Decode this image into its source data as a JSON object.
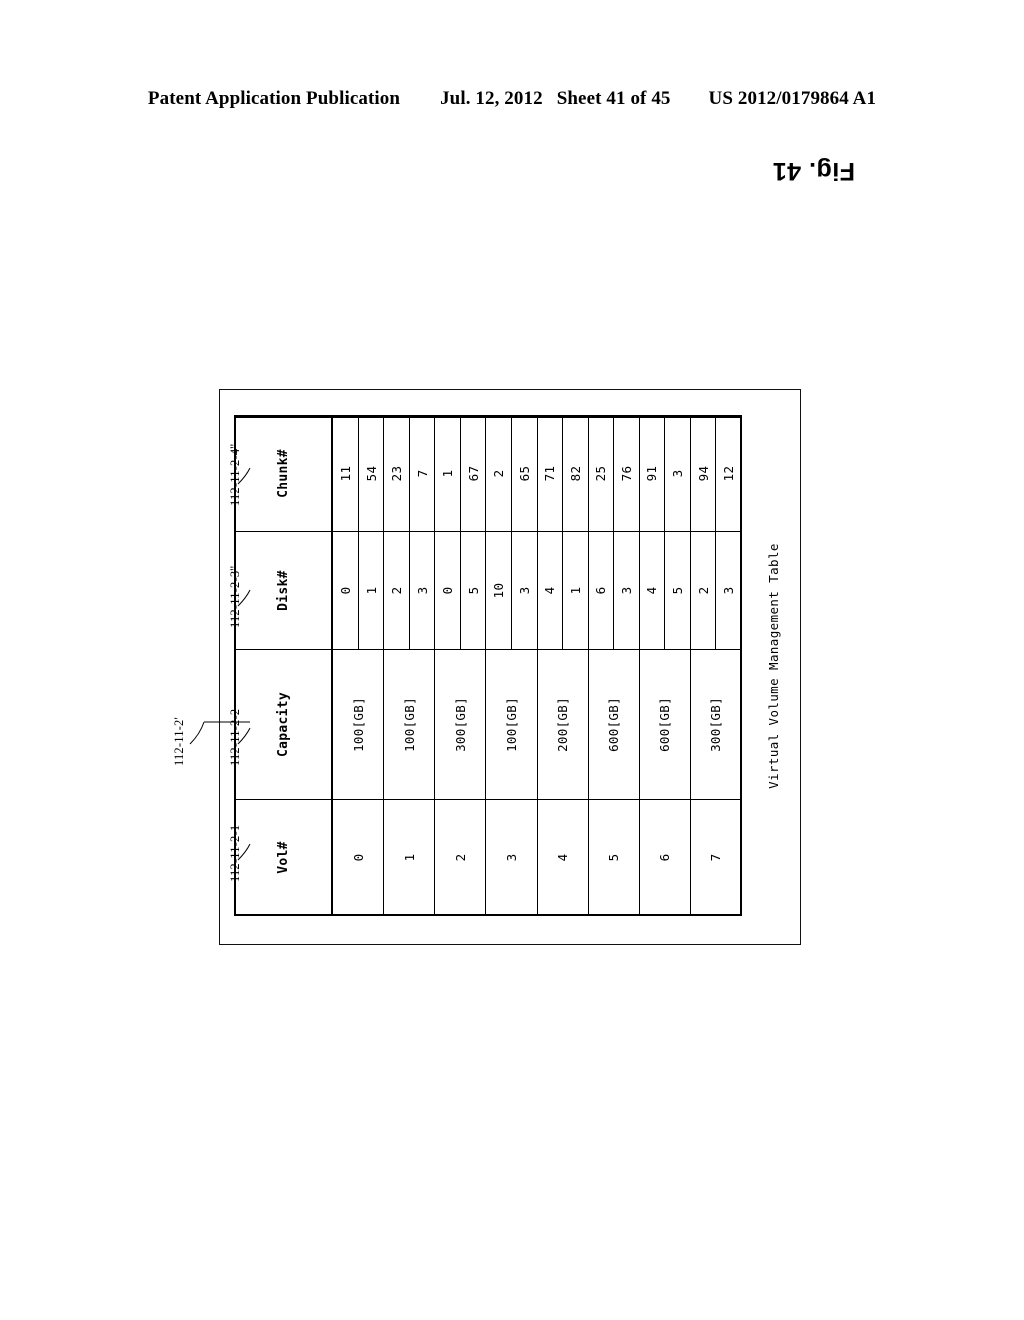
{
  "header": {
    "publication": "Patent Application Publication",
    "date": "Jul. 12, 2012",
    "sheet": "Sheet 41 of 45",
    "patent_number": "US 2012/0179864 A1"
  },
  "figure": {
    "caption": "Fig. 41",
    "table_title": "Virtual Volume Management Table",
    "reference_numerals": {
      "table": "112-11-2'",
      "vol_column": "112-11-2-1",
      "capacity_column": "112-11-2-2",
      "disk_column": "112-11-2-3''",
      "chunk_column": "112-11-2-4''"
    }
  },
  "table": {
    "columns": [
      "Vol#",
      "Capacity",
      "Disk#",
      "Chunk#"
    ],
    "rows": [
      {
        "vol": "0",
        "capacity": "100[GB]",
        "entries": [
          {
            "disk": "0",
            "chunk": "11"
          },
          {
            "disk": "1",
            "chunk": "54"
          }
        ]
      },
      {
        "vol": "1",
        "capacity": "100[GB]",
        "entries": [
          {
            "disk": "2",
            "chunk": "23"
          },
          {
            "disk": "3",
            "chunk": "7"
          }
        ]
      },
      {
        "vol": "2",
        "capacity": "300[GB]",
        "entries": [
          {
            "disk": "0",
            "chunk": "1"
          },
          {
            "disk": "5",
            "chunk": "67"
          }
        ]
      },
      {
        "vol": "3",
        "capacity": "100[GB]",
        "entries": [
          {
            "disk": "10",
            "chunk": "2"
          },
          {
            "disk": "3",
            "chunk": "65"
          }
        ]
      },
      {
        "vol": "4",
        "capacity": "200[GB]",
        "entries": [
          {
            "disk": "4",
            "chunk": "71"
          },
          {
            "disk": "1",
            "chunk": "82"
          }
        ]
      },
      {
        "vol": "5",
        "capacity": "600[GB]",
        "entries": [
          {
            "disk": "6",
            "chunk": "25"
          },
          {
            "disk": "3",
            "chunk": "76"
          }
        ]
      },
      {
        "vol": "6",
        "capacity": "600[GB]",
        "entries": [
          {
            "disk": "4",
            "chunk": "91"
          },
          {
            "disk": "5",
            "chunk": "3"
          }
        ]
      },
      {
        "vol": "7",
        "capacity": "300[GB]",
        "entries": [
          {
            "disk": "2",
            "chunk": "94"
          },
          {
            "disk": "3",
            "chunk": "12"
          }
        ]
      }
    ]
  }
}
